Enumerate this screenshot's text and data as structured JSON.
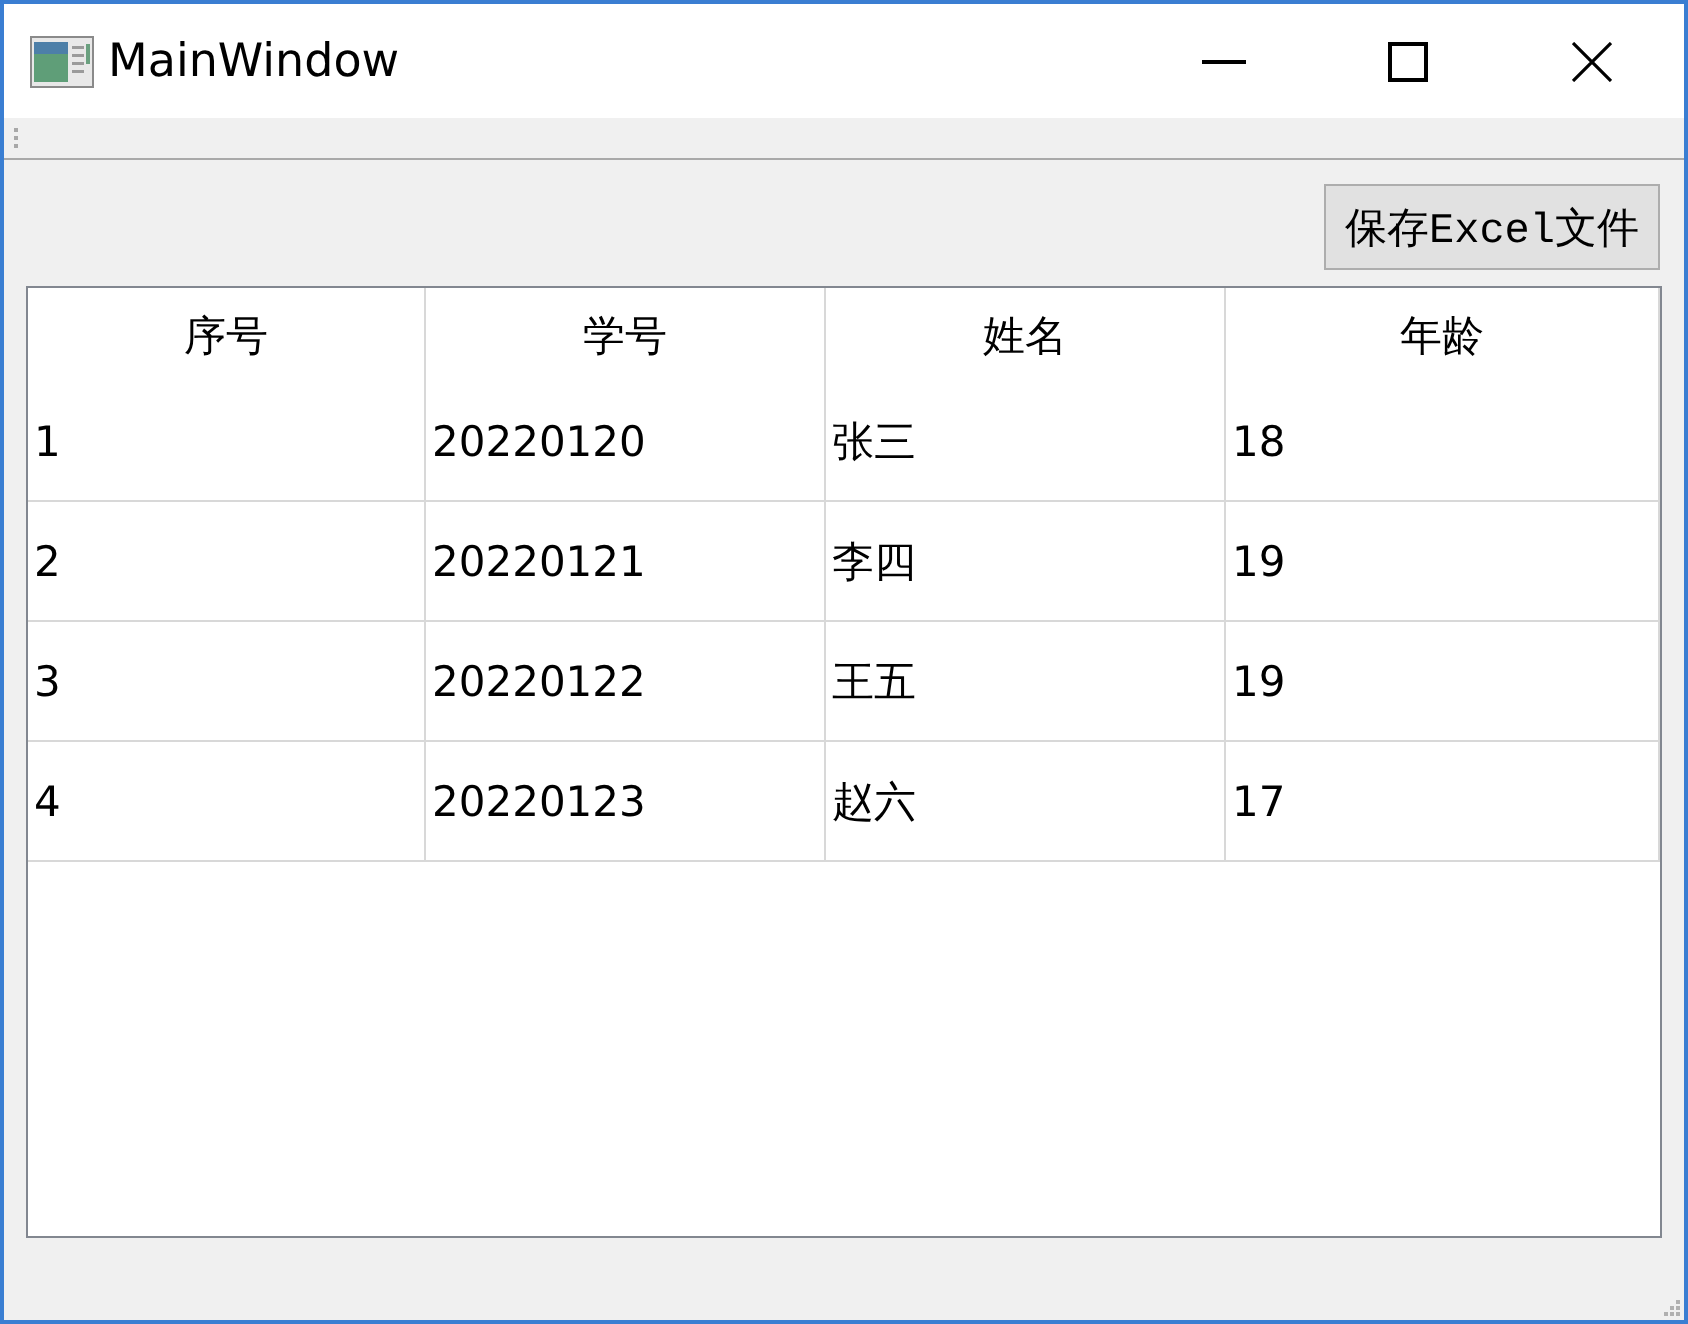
{
  "window": {
    "title": "MainWindow"
  },
  "toolbar": {
    "save_button": "保存Excel文件"
  },
  "table": {
    "columns": [
      "序号",
      "学号",
      "姓名",
      "年龄"
    ],
    "rows": [
      [
        "1",
        "20220120",
        "张三",
        "18"
      ],
      [
        "2",
        "20220121",
        "李四",
        "19"
      ],
      [
        "3",
        "20220122",
        "王五",
        "19"
      ],
      [
        "4",
        "20220123",
        "赵六",
        "17"
      ]
    ]
  }
}
